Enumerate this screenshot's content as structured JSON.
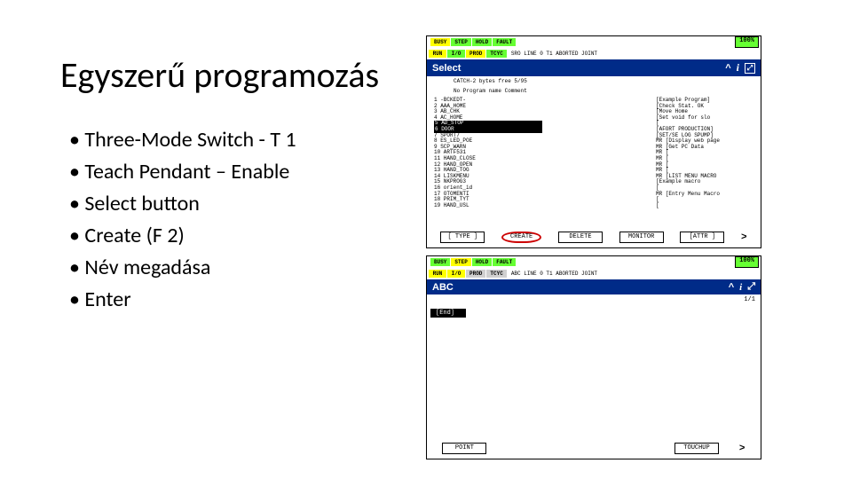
{
  "title": "Egyszerű programozás",
  "bullets": {
    "b1": "Three-Mode Switch - T 1",
    "b2": "Teach Pendant – Enable",
    "b3": "Select button",
    "b4": "Create (F 2)",
    "b5": "Név megadása",
    "b6": "Enter"
  },
  "shot1": {
    "badges": {
      "busy": "BUSY",
      "step": "STEP",
      "hold": "HOLD",
      "fault": "FAULT",
      "run": "RUN",
      "io": "I/O",
      "prod": "PROD",
      "tcyc": "TCYC"
    },
    "status_line": "SRO  LINE 0   T1   ABORTED  JOINT",
    "pct": "100%",
    "titlebar": "Select",
    "head": "CATCH-2 bytes free       5/95",
    "cols": "No   Program name        Comment",
    "left": {
      "r1": "1   -BCKEDT-",
      "r2": "2   AAA_HOME",
      "r3": "3   AB_CHK",
      "r4": "4   AC_HOME",
      "r5": "5   AD_STOP",
      "r6": "6   DOOR",
      "r7": "7   SPORT7",
      "r8": "8   ES_LED_POE",
      "r9": "9   SCP_WARN",
      "r10": "10  ARTF531",
      "r11": "11  HAND_CLOSE",
      "r12": "12  HAND_OPEN",
      "r13": "13  HAND_TOG",
      "r14": "14  LISKMENU",
      "r15": "15  NKPROG3",
      "r16": "16  orient_id",
      "r17": "17  OTOMENTI",
      "r18": "18  PRIM_TYT",
      "r19": "19  HAND_USL"
    },
    "right": {
      "r1": "[Example Program]",
      "r2": "[Check Stat. OK",
      "r3": "[Move Home",
      "r4": "[Set void for slo",
      "r5": "[",
      "r6": "[AFORT PRODUCTION]",
      "r7": "[SET/SE LOG SPUMP]",
      "r8": "MR [Display web page",
      "r9": "MR [Get PC Data",
      "r10": "MR [",
      "r11": "MR [",
      "r12": "MR [",
      "r13": "MR [",
      "r14": "MR [LIST MENU MACRO",
      "r15": "[Example macro",
      "r16": "[",
      "r17": "MR [Entry Menu Macro",
      "r18": "[",
      "r19": "["
    },
    "fn": {
      "type": "[ TYPE ]",
      "create": "CREATE",
      "delete": "DELETE",
      "monitor": "MONITOR",
      "attr": "[ATTR ]",
      "arrow": ">"
    }
  },
  "shot2": {
    "badges": {
      "busy": "BUSY",
      "step": "STEP",
      "hold": "HOLD",
      "fault": "FAULT",
      "run": "RUN",
      "io": "I/O",
      "prod": "PROD",
      "tcyc": "TCYC"
    },
    "status_line": "ABC  LINE 0   T1   ABORTED  JOINT",
    "pct": "100%",
    "titlebar": "ABC",
    "frac": "1/1",
    "field": "[End]",
    "fn": {
      "point": "POINT",
      "touchup": "TOUCHUP",
      "arrow": ">"
    }
  }
}
